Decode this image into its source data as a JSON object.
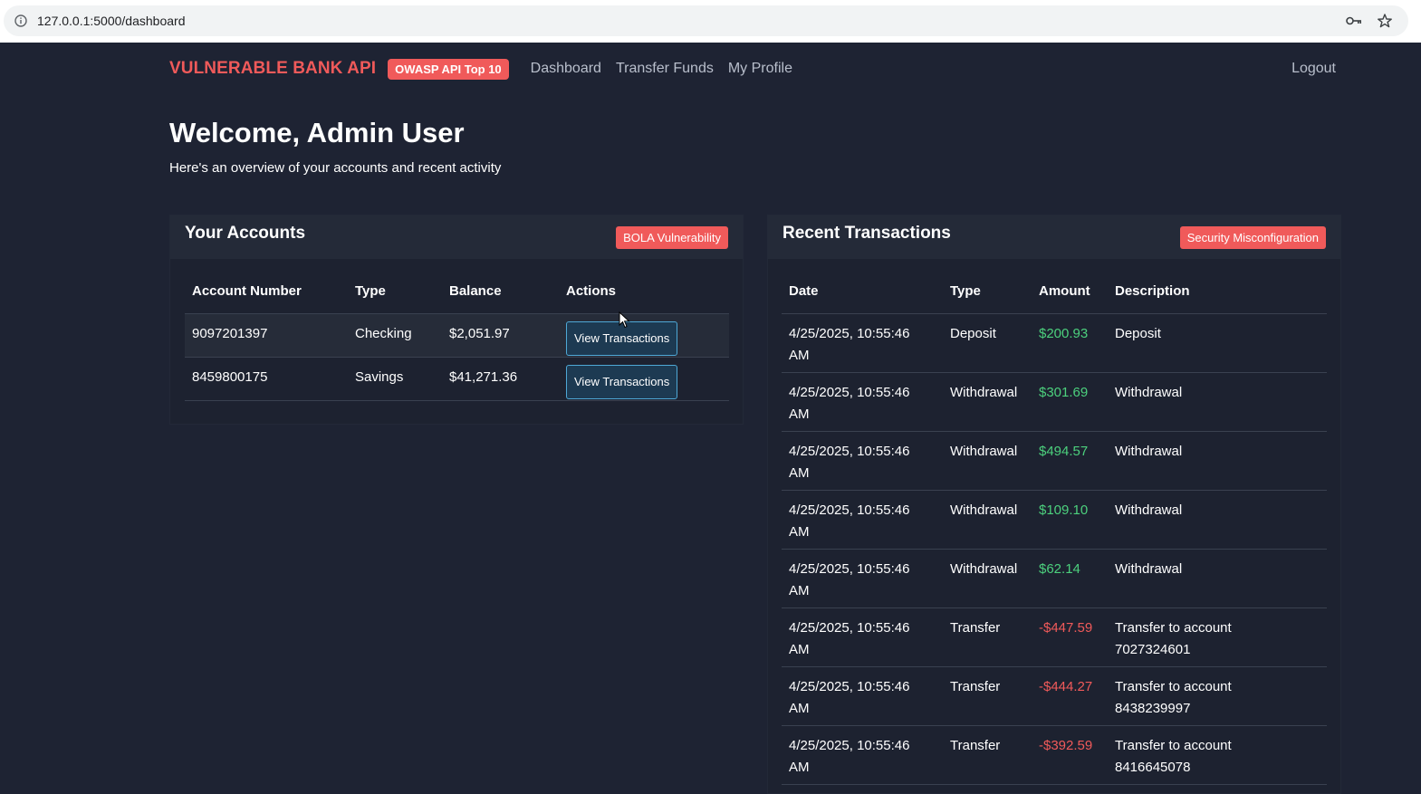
{
  "browser": {
    "url": "127.0.0.1:5000/dashboard"
  },
  "nav": {
    "brand": "VULNERABLE BANK API",
    "badge": "OWASP API Top 10",
    "links": [
      "Dashboard",
      "Transfer Funds",
      "My Profile"
    ],
    "logout": "Logout"
  },
  "welcome": {
    "title": "Welcome, Admin User",
    "subtitle": "Here's an overview of your accounts and recent activity"
  },
  "accounts": {
    "title": "Your Accounts",
    "badge": "BOLA Vulnerability",
    "columns": [
      "Account Number",
      "Type",
      "Balance",
      "Actions"
    ],
    "rows": [
      {
        "number": "9097201397",
        "type": "Checking",
        "balance": "$2,051.97",
        "action": "View Transactions"
      },
      {
        "number": "8459800175",
        "type": "Savings",
        "balance": "$41,271.36",
        "action": "View Transactions"
      }
    ]
  },
  "transactions": {
    "title": "Recent Transactions",
    "badge": "Security Misconfiguration",
    "columns": [
      "Date",
      "Type",
      "Amount",
      "Description"
    ],
    "rows": [
      {
        "date_line1": "4/25/2025, 10:55:46",
        "date_line2": "AM",
        "type": "Deposit",
        "amount": "$200.93",
        "desc_line1": "Deposit",
        "desc_line2": ""
      },
      {
        "date_line1": "4/25/2025, 10:55:46",
        "date_line2": "AM",
        "type": "Withdrawal",
        "amount": "$301.69",
        "desc_line1": "Withdrawal",
        "desc_line2": ""
      },
      {
        "date_line1": "4/25/2025, 10:55:46",
        "date_line2": "AM",
        "type": "Withdrawal",
        "amount": "$494.57",
        "desc_line1": "Withdrawal",
        "desc_line2": ""
      },
      {
        "date_line1": "4/25/2025, 10:55:46",
        "date_line2": "AM",
        "type": "Withdrawal",
        "amount": "$109.10",
        "desc_line1": "Withdrawal",
        "desc_line2": ""
      },
      {
        "date_line1": "4/25/2025, 10:55:46",
        "date_line2": "AM",
        "type": "Withdrawal",
        "amount": "$62.14",
        "desc_line1": "Withdrawal",
        "desc_line2": ""
      },
      {
        "date_line1": "4/25/2025, 10:55:46",
        "date_line2": "AM",
        "type": "Transfer",
        "amount": "-$447.59",
        "desc_line1": "Transfer to account",
        "desc_line2": "7027324601"
      },
      {
        "date_line1": "4/25/2025, 10:55:46",
        "date_line2": "AM",
        "type": "Transfer",
        "amount": "-$444.27",
        "desc_line1": "Transfer to account",
        "desc_line2": "8438239997"
      },
      {
        "date_line1": "4/25/2025, 10:55:46",
        "date_line2": "AM",
        "type": "Transfer",
        "amount": "-$392.59",
        "desc_line1": "Transfer to account",
        "desc_line2": "8416645078"
      }
    ]
  },
  "colors": {
    "brand": "#f05a5a",
    "positive": "#4cd07d",
    "negative": "#f05a5a",
    "background": "#1e2333"
  }
}
